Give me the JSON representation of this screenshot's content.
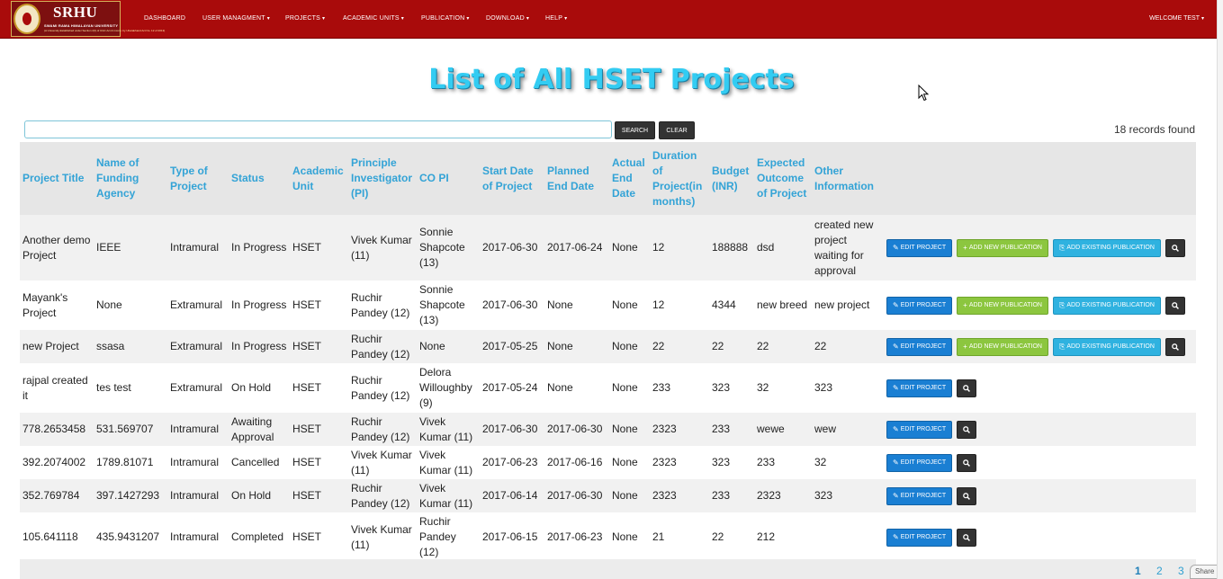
{
  "navbar": {
    "logo": {
      "brand": "SRHU",
      "university": "SWAMI RAMA HIMALAYAN UNIVERSITY",
      "subtitle": "(A University Established under Section 2(f) of UGC Act & Incorp. by Uttarakhand Act No. 12 of 2013)"
    },
    "items": [
      {
        "label": "DASHBOARD",
        "dropdown": false
      },
      {
        "label": "USER MANAGMENT",
        "dropdown": true
      },
      {
        "label": "PROJECTS",
        "dropdown": true
      },
      {
        "label": "ACADEMIC UNITS",
        "dropdown": true
      },
      {
        "label": "PUBLICATION",
        "dropdown": true
      },
      {
        "label": "DOWNLOAD",
        "dropdown": true
      },
      {
        "label": "HELP",
        "dropdown": true
      }
    ],
    "welcome": "WELCOME TEST"
  },
  "page": {
    "title": "List of All HSET Projects"
  },
  "search": {
    "value": "",
    "placeholder": "",
    "search_label": "SEARCH",
    "clear_label": "CLEAR",
    "records_found": "18 records found"
  },
  "table": {
    "headers": [
      "Project Title",
      "Name of Funding Agency",
      "Type of Project",
      "Status",
      "Academic Unit",
      "Principle Investigator (PI)",
      "CO PI",
      "Start Date of Project",
      "Planned End Date",
      "Actual End Date",
      "Duration of Project(in months)",
      "Budget (INR)",
      "Expected Outcome of Project",
      "Other Information",
      ""
    ],
    "rows": [
      {
        "cells": [
          "Another demo Project",
          "IEEE",
          "Intramural",
          "In Progress",
          "HSET",
          "Vivek Kumar (11)",
          "Sonnie Shapcote (13)",
          "2017-06-30",
          "2017-06-24",
          "None",
          "12",
          "188888",
          "dsd",
          "created new project waiting for approval"
        ],
        "publication_actions": true
      },
      {
        "cells": [
          "Mayank's Project",
          "None",
          "Extramural",
          "In Progress",
          "HSET",
          "Ruchir Pandey (12)",
          "Sonnie Shapcote (13)",
          "2017-06-30",
          "None",
          "None",
          "12",
          "4344",
          "new breed",
          "new project"
        ],
        "publication_actions": true
      },
      {
        "cells": [
          "new Project",
          "ssasa",
          "Extramural",
          "In Progress",
          "HSET",
          "Ruchir Pandey (12)",
          "None",
          "2017-05-25",
          "None",
          "None",
          "22",
          "22",
          "22",
          "22"
        ],
        "publication_actions": true
      },
      {
        "cells": [
          "rajpal created it",
          "tes test",
          "Extramural",
          "On Hold",
          "HSET",
          "Ruchir Pandey (12)",
          "Delora Willoughby (9)",
          "2017-05-24",
          "None",
          "None",
          "233",
          "323",
          "32",
          "323"
        ],
        "publication_actions": false
      },
      {
        "cells": [
          "778.2653458",
          "531.569707",
          "Intramural",
          "Awaiting Approval",
          "HSET",
          "Ruchir Pandey (12)",
          "Vivek Kumar (11)",
          "2017-06-30",
          "2017-06-30",
          "None",
          "2323",
          "233",
          "wewe",
          "wew"
        ],
        "publication_actions": false
      },
      {
        "cells": [
          "392.2074002",
          "1789.81071",
          "Intramural",
          "Cancelled",
          "HSET",
          "Vivek Kumar (11)",
          "Vivek Kumar (11)",
          "2017-06-23",
          "2017-06-16",
          "None",
          "2323",
          "323",
          "233",
          "32"
        ],
        "publication_actions": false
      },
      {
        "cells": [
          "352.769784",
          "397.1427293",
          "Intramural",
          "On Hold",
          "HSET",
          "Ruchir Pandey (12)",
          "Vivek Kumar (11)",
          "2017-06-14",
          "2017-06-30",
          "None",
          "2323",
          "233",
          "2323",
          "323"
        ],
        "publication_actions": false
      },
      {
        "cells": [
          "105.641118",
          "435.9431207",
          "Intramural",
          "Completed",
          "HSET",
          "Vivek Kumar (11)",
          "Ruchir Pandey (12)",
          "2017-06-15",
          "2017-06-23",
          "None",
          "21",
          "22",
          "212",
          ""
        ],
        "publication_actions": false
      }
    ],
    "actions": {
      "edit": "EDIT PROJECT",
      "add_new": "ADD NEW PUBLICATION",
      "add_existing": "ADD EXISTING PUBLICATION"
    }
  },
  "pagination": {
    "pages": [
      "1",
      "2",
      "3"
    ],
    "current": "1"
  },
  "share": {
    "label": "Share"
  },
  "colors": {
    "navbar": "#a90b0b",
    "title": "#33ccf2",
    "header_text": "#33a3d6",
    "edit_button": "#1a7fd3",
    "add_new_button": "#8cc63f",
    "add_existing_button": "#2fb2e0",
    "dark_button": "#333333"
  }
}
